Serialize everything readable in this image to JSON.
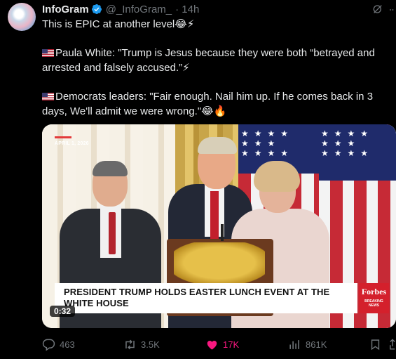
{
  "author": {
    "name": "InfoGram",
    "handle": "@_InfoGram_",
    "time": "· 14h"
  },
  "tweet": {
    "line1": "This is EPIC at another level😂⚡",
    "line2": "Paula White: \"Trump is Jesus because they were both “betrayed and arrested and falsely accused.”⚡",
    "line3": "Democrats leaders: \"Fair enough. Nail him up. If he comes back in 3 days, We'll admit we were wrong.\"😂🔥"
  },
  "video": {
    "date": "APRIL 1, 2026",
    "headline": "PRESIDENT TRUMP HOLDS EASTER LUNCH EVENT AT THE WHITE HOUSE",
    "network": "Forbes",
    "network_tag": "BREAKING NEWS",
    "duration": "0:32"
  },
  "actions": {
    "replies": "463",
    "reposts": "3.5K",
    "likes": "17K",
    "views": "861K"
  },
  "colors": {
    "background": "#000000",
    "text": "#e7e9ea",
    "muted": "#71767b",
    "verified": "#1d9bf0",
    "like": "#f91880",
    "forbes_red": "#d4202c"
  },
  "icons": [
    "verified-badge-icon",
    "grok-icon",
    "more-icon",
    "us-flag-icon",
    "reply-icon",
    "repost-icon",
    "like-icon",
    "views-icon",
    "bookmark-icon",
    "share-icon"
  ]
}
